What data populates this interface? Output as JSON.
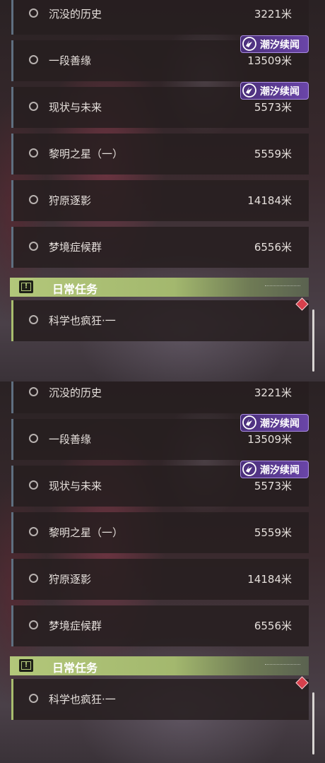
{
  "panels": [
    {
      "quests": [
        {
          "name": "沉没的历史",
          "distance": "3221米"
        },
        {
          "name": "一段善缘",
          "distance": "13509米",
          "badge": "潮汐续闻"
        },
        {
          "name": "现状与未来",
          "distance": "5573米",
          "badge": "潮汐续闻"
        },
        {
          "name": "黎明之星（一）",
          "distance": "5559米"
        },
        {
          "name": "狩原逐影",
          "distance": "14184米"
        },
        {
          "name": "梦境症候群",
          "distance": "6556米"
        }
      ],
      "section": {
        "title": "日常任务"
      },
      "daily": [
        {
          "name": "科学也疯狂·一"
        }
      ]
    },
    {
      "quests": [
        {
          "name": "沉没的历史",
          "distance": "3221米"
        },
        {
          "name": "一段善缘",
          "distance": "13509米",
          "badge": "潮汐续闻"
        },
        {
          "name": "现状与未来",
          "distance": "5573米",
          "badge": "潮汐续闻"
        },
        {
          "name": "黎明之星（一）",
          "distance": "5559米"
        },
        {
          "name": "狩原逐影",
          "distance": "14184米"
        },
        {
          "name": "梦境症候群",
          "distance": "6556米"
        }
      ],
      "section": {
        "title": "日常任务"
      },
      "daily": [
        {
          "name": "科学也疯狂·一"
        }
      ]
    }
  ],
  "icons": {
    "quest_status": "radio-circle-icon",
    "badge": "tide-mark-icon",
    "section": "alert-square-icon",
    "alert": "red-diamond-icon"
  },
  "colors": {
    "badge_bg": "#5a3a93",
    "section_accent": "#b3c77a",
    "alert": "#d8404c"
  }
}
